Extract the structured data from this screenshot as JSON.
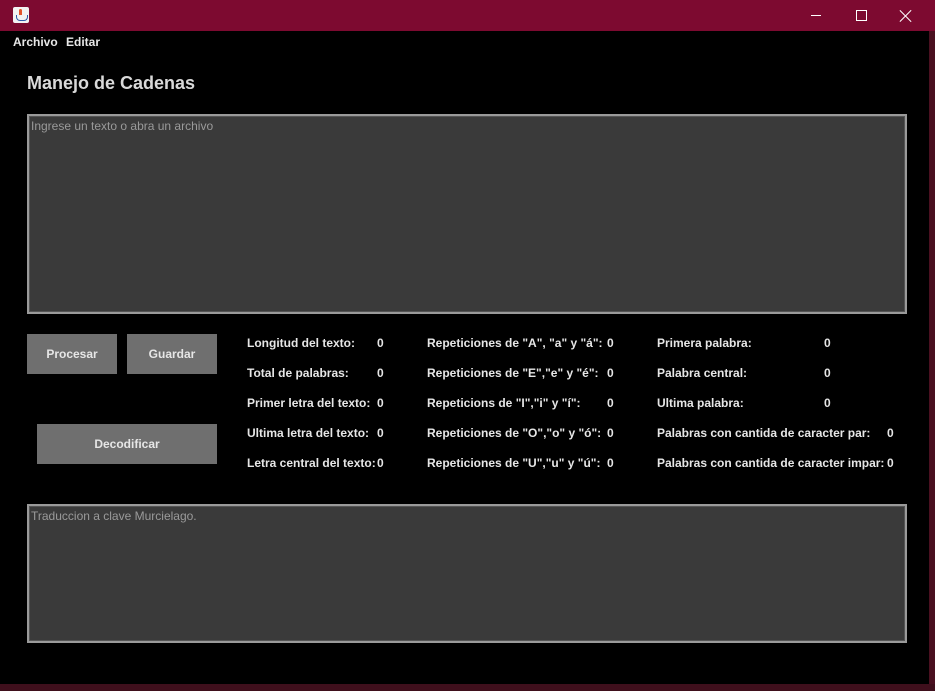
{
  "menu": {
    "archivo": "Archivo",
    "editar": "Editar"
  },
  "page_title": "Manejo de Cadenas",
  "input": {
    "placeholder": "Ingrese un texto o abra un archivo",
    "value": ""
  },
  "output": {
    "placeholder": "Traduccion a clave Murcielago.",
    "value": ""
  },
  "buttons": {
    "procesar": "Procesar",
    "guardar": "Guardar",
    "decodificar": "Decodificar"
  },
  "stats": {
    "col1": [
      {
        "label": "Longitud del texto:",
        "value": "0"
      },
      {
        "label": "Total de palabras:",
        "value": "0"
      },
      {
        "label": "Primer letra del texto:",
        "value": "0"
      },
      {
        "label": "Ultima letra del texto:",
        "value": "0"
      },
      {
        "label": "Letra central del texto:",
        "value": "0"
      }
    ],
    "col2": [
      {
        "label": "Repeticiones de \"A\", \"a\" y \"á\":",
        "value": "0"
      },
      {
        "label": "Repeticiones de \"E\",\"e\" y \"é\":",
        "value": "0"
      },
      {
        "label": "Repeticions de \"I\",\"i\" y \"í\":",
        "value": "0"
      },
      {
        "label": "Repeticiones de \"O\",\"o\" y \"ó\":",
        "value": "0"
      },
      {
        "label": "Repeticiones de \"U\",\"u\" y \"ú\":",
        "value": "0"
      }
    ],
    "col3": [
      {
        "label": "Primera palabra:",
        "value": "0"
      },
      {
        "label": "Palabra central:",
        "value": "0"
      },
      {
        "label": "Ultima palabra:",
        "value": "0"
      },
      {
        "label": "Palabras con cantida de caracter par:",
        "value": "0"
      },
      {
        "label": "Palabras con cantida de caracter impar:",
        "value": "0"
      }
    ]
  },
  "colors": {
    "titlebar": "#7d0a30",
    "background": "#000000",
    "button": "#6f6f6f",
    "textarea": "#3a3a3a"
  },
  "icons": {
    "app": "java-icon",
    "minimize": "minimize-icon",
    "maximize": "maximize-icon",
    "close": "close-icon"
  }
}
